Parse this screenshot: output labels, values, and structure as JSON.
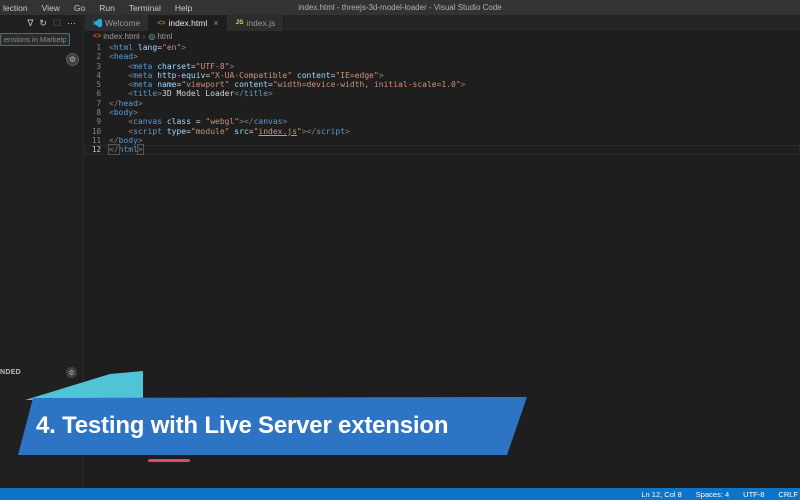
{
  "window": {
    "title": "index.html - threejs-3d-model-loader - Visual Studio Code"
  },
  "menu": {
    "items": [
      "lection",
      "View",
      "Go",
      "Run",
      "Terminal",
      "Help"
    ]
  },
  "icons": {
    "html-icon": "<>",
    "js-icon": "JS",
    "close-icon": "×",
    "filter-icon": "∇",
    "refresh-icon": "↻",
    "clear-icon": "☐",
    "more-actions-icon": "⋯",
    "gear-icon": "⚙",
    "symbol-icon": "◎",
    "crumb-sep": "›"
  },
  "sidebar": {
    "search_placeholder": "ensions in Marketplace",
    "toolbar": [
      {
        "name": "filter-icon",
        "glyph_key": "filter-icon",
        "dim": false
      },
      {
        "name": "refresh-icon",
        "glyph_key": "refresh-icon",
        "dim": false
      },
      {
        "name": "clear-icon",
        "glyph_key": "clear-icon",
        "dim": true
      },
      {
        "name": "more-actions-icon",
        "glyph_key": "more-actions-icon",
        "dim": false
      }
    ],
    "section_label": "NDED"
  },
  "tabs": [
    {
      "id": "welcome",
      "label": "Welcome",
      "icon": "vscode-logo-icon",
      "active": false,
      "closable": false
    },
    {
      "id": "index-html",
      "label": "index.html",
      "icon": "html-icon",
      "active": true,
      "closable": true
    },
    {
      "id": "index-js",
      "label": "index.js",
      "icon": "js-icon",
      "active": false,
      "closable": false
    }
  ],
  "breadcrumb": {
    "items": [
      {
        "icon": "html-icon",
        "label": "index.html"
      },
      {
        "icon": "symbol-icon",
        "label": "html"
      }
    ]
  },
  "editor": {
    "lines": [
      {
        "n": "1",
        "tokens": [
          [
            "p",
            "<"
          ],
          [
            "t",
            "html"
          ],
          [
            "w",
            " "
          ],
          [
            "a",
            "lang"
          ],
          [
            "o",
            "="
          ],
          [
            "v",
            "\"en\""
          ],
          [
            "p",
            ">"
          ]
        ]
      },
      {
        "n": "2",
        "tokens": [
          [
            "p",
            "<"
          ],
          [
            "t",
            "head"
          ],
          [
            "p",
            ">"
          ]
        ]
      },
      {
        "n": "3",
        "tokens": [
          [
            "w",
            "    "
          ],
          [
            "p",
            "<"
          ],
          [
            "t",
            "meta"
          ],
          [
            "w",
            " "
          ],
          [
            "a",
            "charset"
          ],
          [
            "o",
            "="
          ],
          [
            "v",
            "\"UTF-8\""
          ],
          [
            "p",
            ">"
          ]
        ]
      },
      {
        "n": "4",
        "tokens": [
          [
            "w",
            "    "
          ],
          [
            "p",
            "<"
          ],
          [
            "t",
            "meta"
          ],
          [
            "w",
            " "
          ],
          [
            "a",
            "http-equiv"
          ],
          [
            "o",
            "="
          ],
          [
            "v",
            "\"X-UA-Compatible\""
          ],
          [
            "w",
            " "
          ],
          [
            "a",
            "content"
          ],
          [
            "o",
            "="
          ],
          [
            "v",
            "\"IE=edge\""
          ],
          [
            "p",
            ">"
          ]
        ]
      },
      {
        "n": "5",
        "tokens": [
          [
            "w",
            "    "
          ],
          [
            "p",
            "<"
          ],
          [
            "t",
            "meta"
          ],
          [
            "w",
            " "
          ],
          [
            "a",
            "name"
          ],
          [
            "o",
            "="
          ],
          [
            "v",
            "\"viewport\""
          ],
          [
            "w",
            " "
          ],
          [
            "a",
            "content"
          ],
          [
            "o",
            "="
          ],
          [
            "v",
            "\"width=device-width, initial-scale=1.0\""
          ],
          [
            "p",
            ">"
          ]
        ]
      },
      {
        "n": "6",
        "tokens": [
          [
            "w",
            "    "
          ],
          [
            "p",
            "<"
          ],
          [
            "t",
            "title"
          ],
          [
            "p",
            ">"
          ],
          [
            "w",
            "3D Model Loader"
          ],
          [
            "p",
            "</"
          ],
          [
            "t",
            "title"
          ],
          [
            "p",
            ">"
          ]
        ]
      },
      {
        "n": "7",
        "tokens": [
          [
            "p",
            "</"
          ],
          [
            "t",
            "head"
          ],
          [
            "p",
            ">"
          ]
        ]
      },
      {
        "n": "8",
        "tokens": [
          [
            "p",
            "<"
          ],
          [
            "t",
            "body"
          ],
          [
            "p",
            ">"
          ]
        ]
      },
      {
        "n": "9",
        "tokens": [
          [
            "w",
            "    "
          ],
          [
            "p",
            "<"
          ],
          [
            "t",
            "canvas"
          ],
          [
            "w",
            " "
          ],
          [
            "a",
            "class"
          ],
          [
            "w",
            " "
          ],
          [
            "o",
            "="
          ],
          [
            "w",
            " "
          ],
          [
            "v",
            "\"webgl\""
          ],
          [
            "p",
            ">"
          ],
          [
            "p",
            "</"
          ],
          [
            "t",
            "canvas"
          ],
          [
            "p",
            ">"
          ]
        ]
      },
      {
        "n": "10",
        "tokens": [
          [
            "w",
            "    "
          ],
          [
            "p",
            "<"
          ],
          [
            "t",
            "script"
          ],
          [
            "w",
            " "
          ],
          [
            "a",
            "type"
          ],
          [
            "o",
            "="
          ],
          [
            "v",
            "\"module\""
          ],
          [
            "w",
            " "
          ],
          [
            "a",
            "src"
          ],
          [
            "o",
            "="
          ],
          [
            "v",
            "\""
          ],
          [
            "link",
            "index.js"
          ],
          [
            "v",
            "\""
          ],
          [
            "p",
            ">"
          ],
          [
            "p",
            "</"
          ],
          [
            "t",
            "script"
          ],
          [
            "p",
            ">"
          ]
        ]
      },
      {
        "n": "11",
        "tokens": [
          [
            "p",
            "</"
          ],
          [
            "t",
            "body"
          ],
          [
            "p",
            ">"
          ]
        ]
      },
      {
        "n": "12",
        "cursor": true,
        "tokens": [
          [
            "hl",
            "</"
          ],
          [
            "t",
            "html"
          ],
          [
            "hl",
            ">"
          ]
        ]
      }
    ]
  },
  "banner": {
    "text": "4. Testing with Live Server extension",
    "blue": "#2e74c4",
    "teal": "#4fc4d6",
    "underline": "#d94a6e"
  },
  "statusbar": {
    "items": [
      {
        "name": "cursor-position",
        "label": "Ln 12, Col 8"
      },
      {
        "name": "indentation",
        "label": "Spaces: 4"
      },
      {
        "name": "encoding",
        "label": "UTF-8"
      },
      {
        "name": "eol",
        "label": "CRLF"
      }
    ]
  },
  "colors": {
    "statusbar": "#0d74c8",
    "menubar": "#333333",
    "editor_bg": "#1e1e1e",
    "sidebar_bg": "#202021"
  }
}
